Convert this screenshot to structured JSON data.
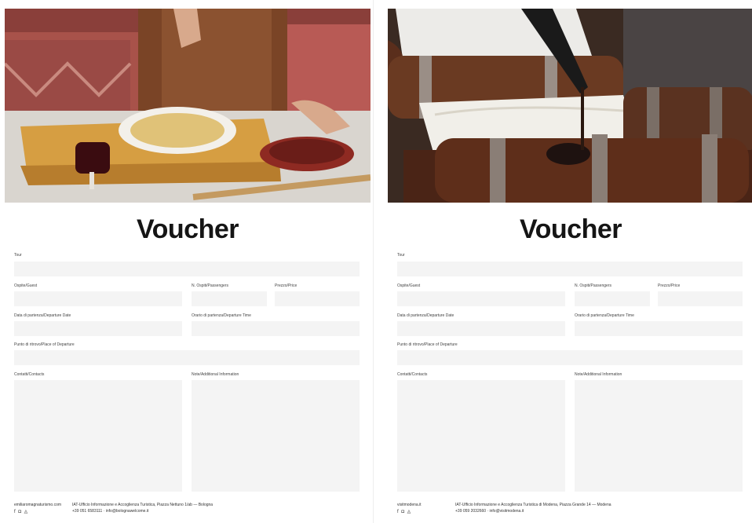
{
  "vouchers": [
    {
      "title": "Voucher",
      "labels": {
        "tour": "Tour",
        "ospite": "Ospite/Guest",
        "n_ospiti": "N. Ospiti/Passengers",
        "prezzo": "Prezzo/Price",
        "data_partenza": "Data di partenza/Departure Date",
        "orario_partenza": "Orario di partenza/Departure Time",
        "punto_ritrovo": "Punto di ritrovo/Place of Departure",
        "contatti": "Contatti/Contacts",
        "note": "Note/Additional Information"
      },
      "footer": {
        "site": "emiliaromagnaturismo.com",
        "social": "f ◘ ◬",
        "line1": "IAT-Ufficio Informazione e Accoglienza Turistica, Piazza Nettuno 1/ab — Bologna",
        "line2": "+39 051 6583111 · info@bolognawelcome.it"
      }
    },
    {
      "title": "Voucher",
      "labels": {
        "tour": "Tour",
        "ospite": "Ospite/Guest",
        "n_ospiti": "N. Ospiti/Passengers",
        "prezzo": "Prezzo/Price",
        "data_partenza": "Data di partenza/Departure Date",
        "orario_partenza": "Orario di partenza/Departure Time",
        "punto_ritrovo": "Punto di ritrovo/Place of Departure",
        "contatti": "Contatti/Contacts",
        "note": "Note/Additional Information"
      },
      "footer": {
        "site": "visitmodena.it",
        "social": "f ◘ ◬",
        "line1": "IAT-Ufficio Informazione e Accoglienza Turistica di Modena, Piazza Grande 14 — Modena",
        "line2": "+39 059 2032660 · info@visitmodena.it"
      }
    }
  ]
}
